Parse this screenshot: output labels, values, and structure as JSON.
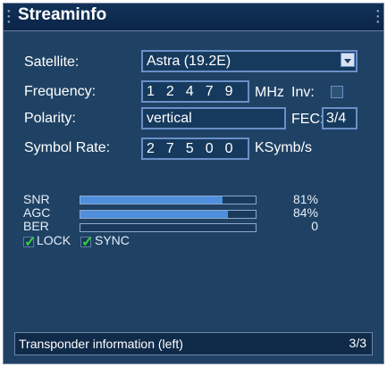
{
  "window": {
    "title": "Streaminfo"
  },
  "fields": {
    "satellite_label": "Satellite:",
    "satellite_value": "Astra (19.2E)",
    "frequency_label": "Frequency:",
    "frequency_value": "12479",
    "frequency_unit": "MHz",
    "inversion_label": "Inv:",
    "polarity_label": "Polarity:",
    "polarity_value": "vertical",
    "fec_label": "FEC:",
    "fec_value": "3/4",
    "symbol_rate_label": "Symbol Rate:",
    "symbol_rate_value": "27500",
    "symbol_rate_unit": "KSymb/s"
  },
  "signal": {
    "snr_label": "SNR",
    "snr_percent": 81,
    "snr_value": "81%",
    "agc_label": "AGC",
    "agc_percent": 84,
    "agc_value": "84%",
    "ber_label": "BER",
    "ber_percent": 0,
    "ber_value": "0",
    "lock_label": "LOCK",
    "sync_label": "SYNC"
  },
  "status": {
    "left_text": "Transponder information (left)",
    "right_text": "3/3"
  },
  "colors": {
    "background": "#1f4264",
    "bar_fill": "#4f8fdd",
    "check": "#33d23b"
  },
  "icons": {
    "dropdown": "chevron-down-icon",
    "check": "check-icon"
  }
}
